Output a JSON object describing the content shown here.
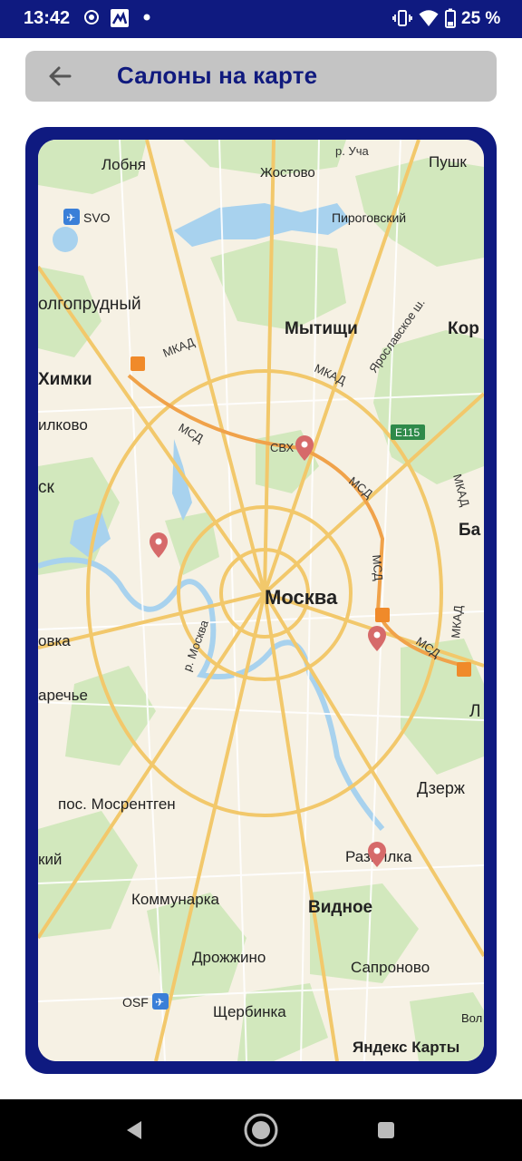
{
  "status_bar": {
    "time": "13:42",
    "battery": "25 %",
    "icons": [
      "target-icon",
      "app-notification-icon",
      "dot-icon",
      "vibrate-icon",
      "wifi-icon",
      "battery-icon"
    ]
  },
  "app_bar": {
    "title": "Салоны на карте",
    "back_icon": "arrow-left-icon"
  },
  "map": {
    "provider_logo": "Яндекс Карты",
    "cities": {
      "lobnya": "Лобня",
      "zhostovo": "Жостово",
      "pushkino": "Пушк",
      "svo": "SVO",
      "pirogovsky": "Пироговский",
      "dolgoprudny": "олгопрудный",
      "mytishchi": "Мытищи",
      "korolev": "Кор",
      "khimki": "Химки",
      "krasnogorsk_part": "илково",
      "krasnogorsk": "ск",
      "moscow": "Москва",
      "balashikha": "Ба",
      "novo": "овка",
      "zarechye": "аречье",
      "lyubertsy": "Л",
      "dzerzhinsky": "Дзерж",
      "mosrentgen": "пос. Мосрентген",
      "razvilka": "Развилка",
      "kiy": "кий",
      "kommunarka": "Коммунарка",
      "vidnoe": "Видное",
      "drozhzhino": "Дрожжино",
      "sapronovo": "Сапроново",
      "osf": "OSF",
      "shcherbinka": "Щербинка",
      "vol": "Вол"
    },
    "roads": {
      "mkad1": "МКАД",
      "mkad2": "МКАД",
      "mkad3": "МКАД",
      "mkad4": "МКАД",
      "msd1": "МСД",
      "msd2": "МСД",
      "msd3": "МСД",
      "msd4": "МСД",
      "svkh": "СВХ",
      "e115": "E115",
      "yaroslavskoe": "Ярославское ш.",
      "moskva_river": "р. Москва",
      "ruza": "р. Уча"
    },
    "markers": [
      {
        "name": "salon-marker",
        "color": "#d66a6a"
      },
      {
        "name": "salon-marker",
        "color": "#d66a6a"
      },
      {
        "name": "salon-marker",
        "color": "#d66a6a"
      },
      {
        "name": "salon-marker",
        "color": "#d66a6a"
      }
    ],
    "colors": {
      "background": "#f6f1e4",
      "forest": "#d2e8bd",
      "water": "#a8d2ee",
      "major_road": "#f2c86b",
      "card_border": "#0f1a80",
      "marker": "#d66a6a",
      "toll": "#f08a2a"
    }
  },
  "nav_bar": {
    "back": "triangle-back-icon",
    "home": "circle-home-icon",
    "recents": "square-recents-icon"
  }
}
